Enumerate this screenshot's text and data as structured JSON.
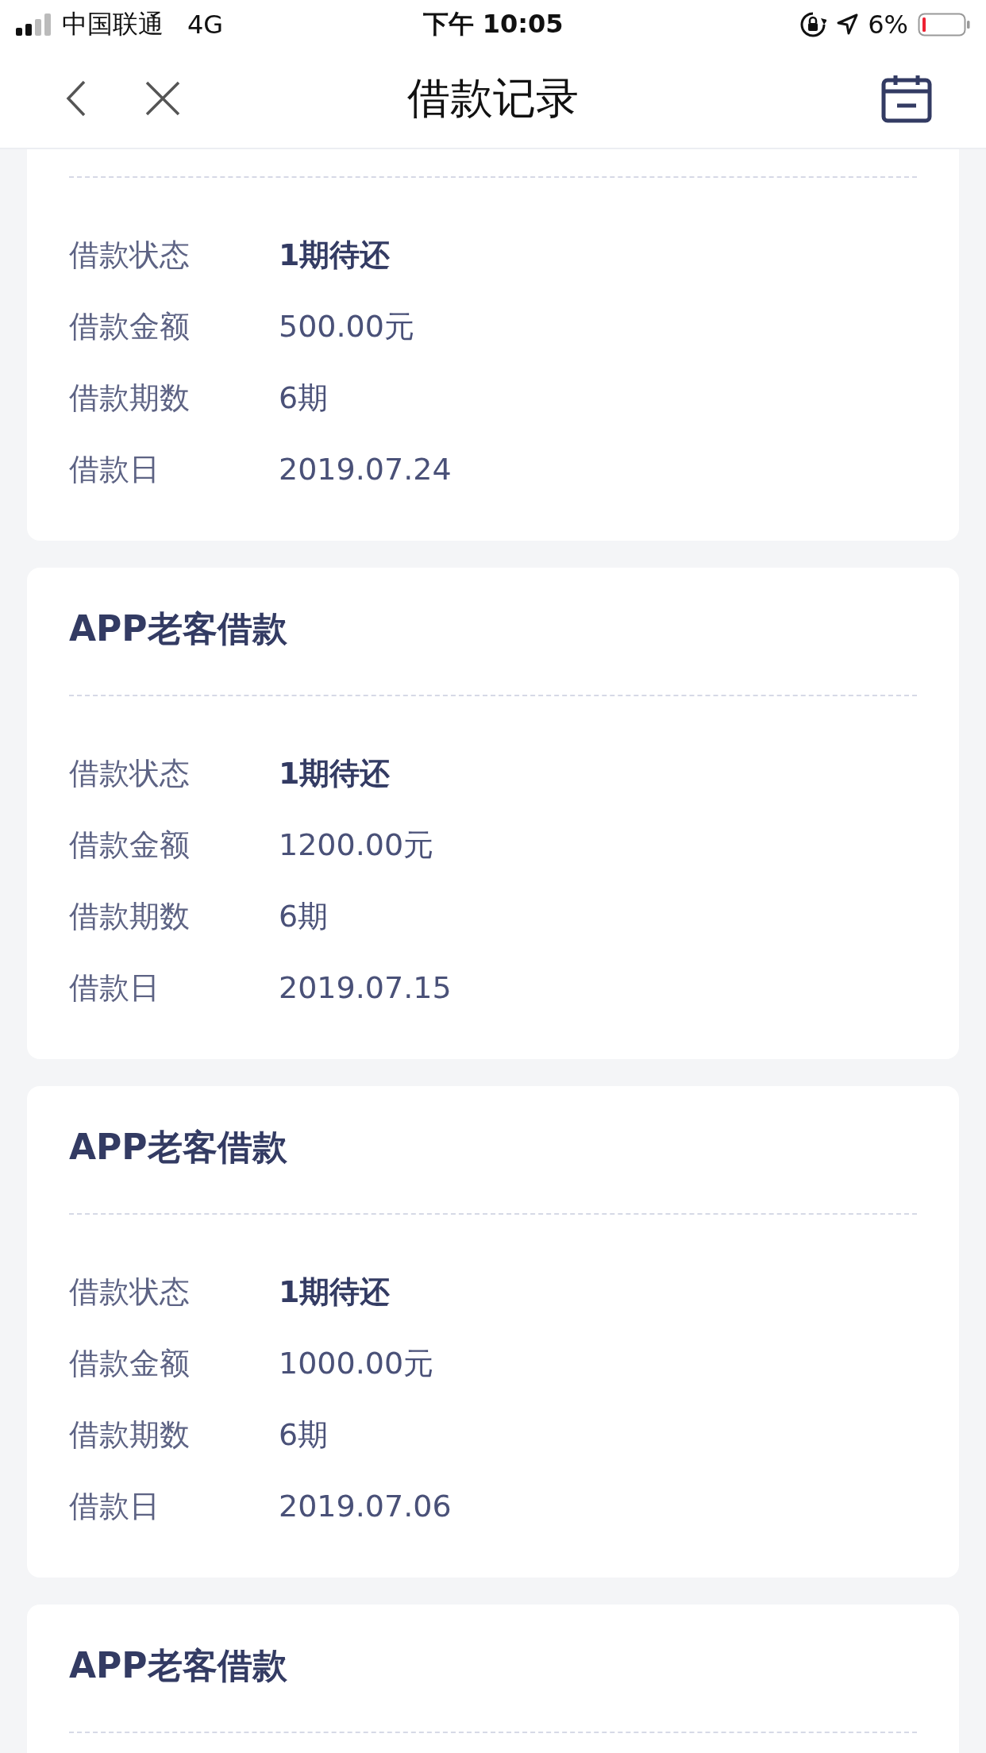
{
  "status_bar": {
    "carrier": "中国联通",
    "network": "4G",
    "time": "下午 10:05",
    "battery": "6%"
  },
  "nav": {
    "title": "借款记录"
  },
  "records": [
    {
      "rows": [
        {
          "label": "借款状态",
          "value": "1期待还",
          "kind": "status"
        },
        {
          "label": "借款金额",
          "value": "500.00元",
          "kind": "plain"
        },
        {
          "label": "借款期数",
          "value": "6期",
          "kind": "plain"
        },
        {
          "label": "借款日",
          "value": "2019.07.24",
          "kind": "plain"
        }
      ]
    },
    {
      "title": "APP老客借款",
      "rows": [
        {
          "label": "借款状态",
          "value": "1期待还",
          "kind": "status"
        },
        {
          "label": "借款金额",
          "value": "1200.00元",
          "kind": "plain"
        },
        {
          "label": "借款期数",
          "value": "6期",
          "kind": "plain"
        },
        {
          "label": "借款日",
          "value": "2019.07.15",
          "kind": "plain"
        }
      ]
    },
    {
      "title": "APP老客借款",
      "rows": [
        {
          "label": "借款状态",
          "value": "1期待还",
          "kind": "status"
        },
        {
          "label": "借款金额",
          "value": "1000.00元",
          "kind": "plain"
        },
        {
          "label": "借款期数",
          "value": "6期",
          "kind": "plain"
        },
        {
          "label": "借款日",
          "value": "2019.07.06",
          "kind": "plain"
        }
      ]
    },
    {
      "title": "APP老客借款"
    }
  ]
}
